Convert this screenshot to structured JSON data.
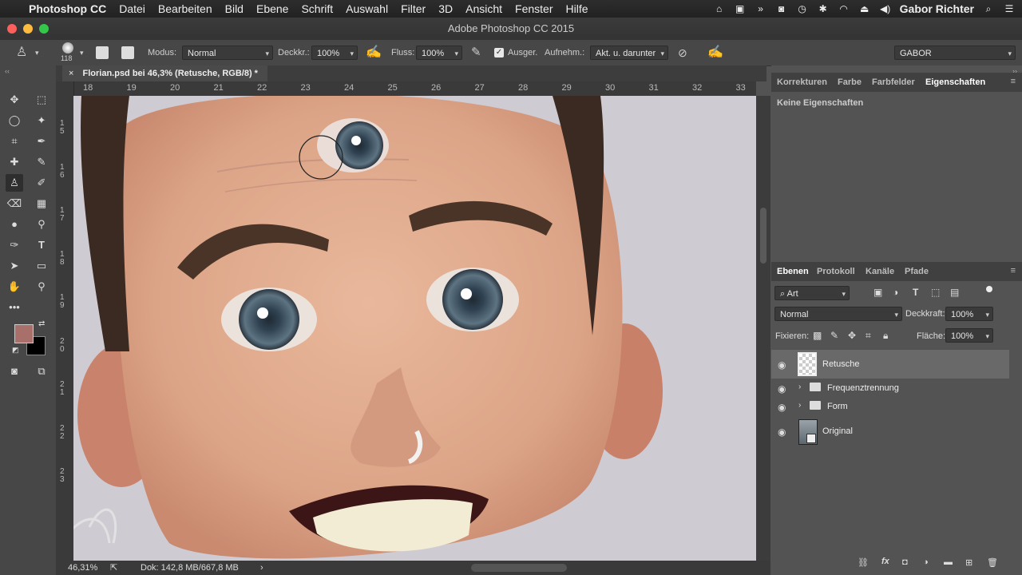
{
  "menubar": {
    "app": "Photoshop CC",
    "items": [
      "Datei",
      "Bearbeiten",
      "Bild",
      "Ebene",
      "Schrift",
      "Auswahl",
      "Filter",
      "3D",
      "Ansicht",
      "Fenster",
      "Hilfe"
    ],
    "user": "Gabor Richter"
  },
  "window": {
    "title": "Adobe Photoshop CC 2015"
  },
  "options": {
    "brush_size": "118",
    "modus_label": "Modus:",
    "modus_value": "Normal",
    "deckkr_label": "Deckkr.:",
    "deckkr_value": "100%",
    "fluss_label": "Fluss:",
    "fluss_value": "100%",
    "ausger_label": "Ausger.",
    "aufnehm_label": "Aufnehm.:",
    "aufnehm_value": "Akt. u. darunter",
    "workspace": "GABOR"
  },
  "document": {
    "tab": "Florian.psd bei 46,3% (Retusche, RGB/8) *",
    "ruler_h": [
      "18",
      "19",
      "20",
      "21",
      "22",
      "23",
      "24",
      "25",
      "26",
      "27",
      "28",
      "29",
      "30",
      "31",
      "32",
      "33"
    ],
    "ruler_v": [
      "1 5",
      "1 6",
      "1 7",
      "1 8",
      "1 9",
      "2 0",
      "2 1",
      "2 2",
      "2 3"
    ],
    "zoom": "46,31%",
    "doc_info": "Dok: 142,8 MB/667,8 MB"
  },
  "colors": {
    "foreground": "#a9706b",
    "background": "#000000"
  },
  "properties_panel": {
    "tabs": [
      "Korrekturen",
      "Farbe",
      "Farbfelder",
      "Eigenschaften"
    ],
    "active_tab": "Eigenschaften",
    "content": "Keine Eigenschaften"
  },
  "layers_panel": {
    "tabs": [
      "Ebenen",
      "Protokoll",
      "Kanäle",
      "Pfade"
    ],
    "active_tab": "Ebenen",
    "filter_kind": "Art",
    "blend_mode": "Normal",
    "opacity_label": "Deckkraft:",
    "opacity_value": "100%",
    "lock_label": "Fixieren:",
    "fill_label": "Fläche:",
    "fill_value": "100%",
    "layers": [
      {
        "name": "Retusche",
        "type": "layer",
        "selected": true
      },
      {
        "name": "Frequenztrennung",
        "type": "group",
        "selected": false
      },
      {
        "name": "Form",
        "type": "group",
        "selected": false
      },
      {
        "name": "Original",
        "type": "smart-object",
        "selected": false
      }
    ]
  }
}
